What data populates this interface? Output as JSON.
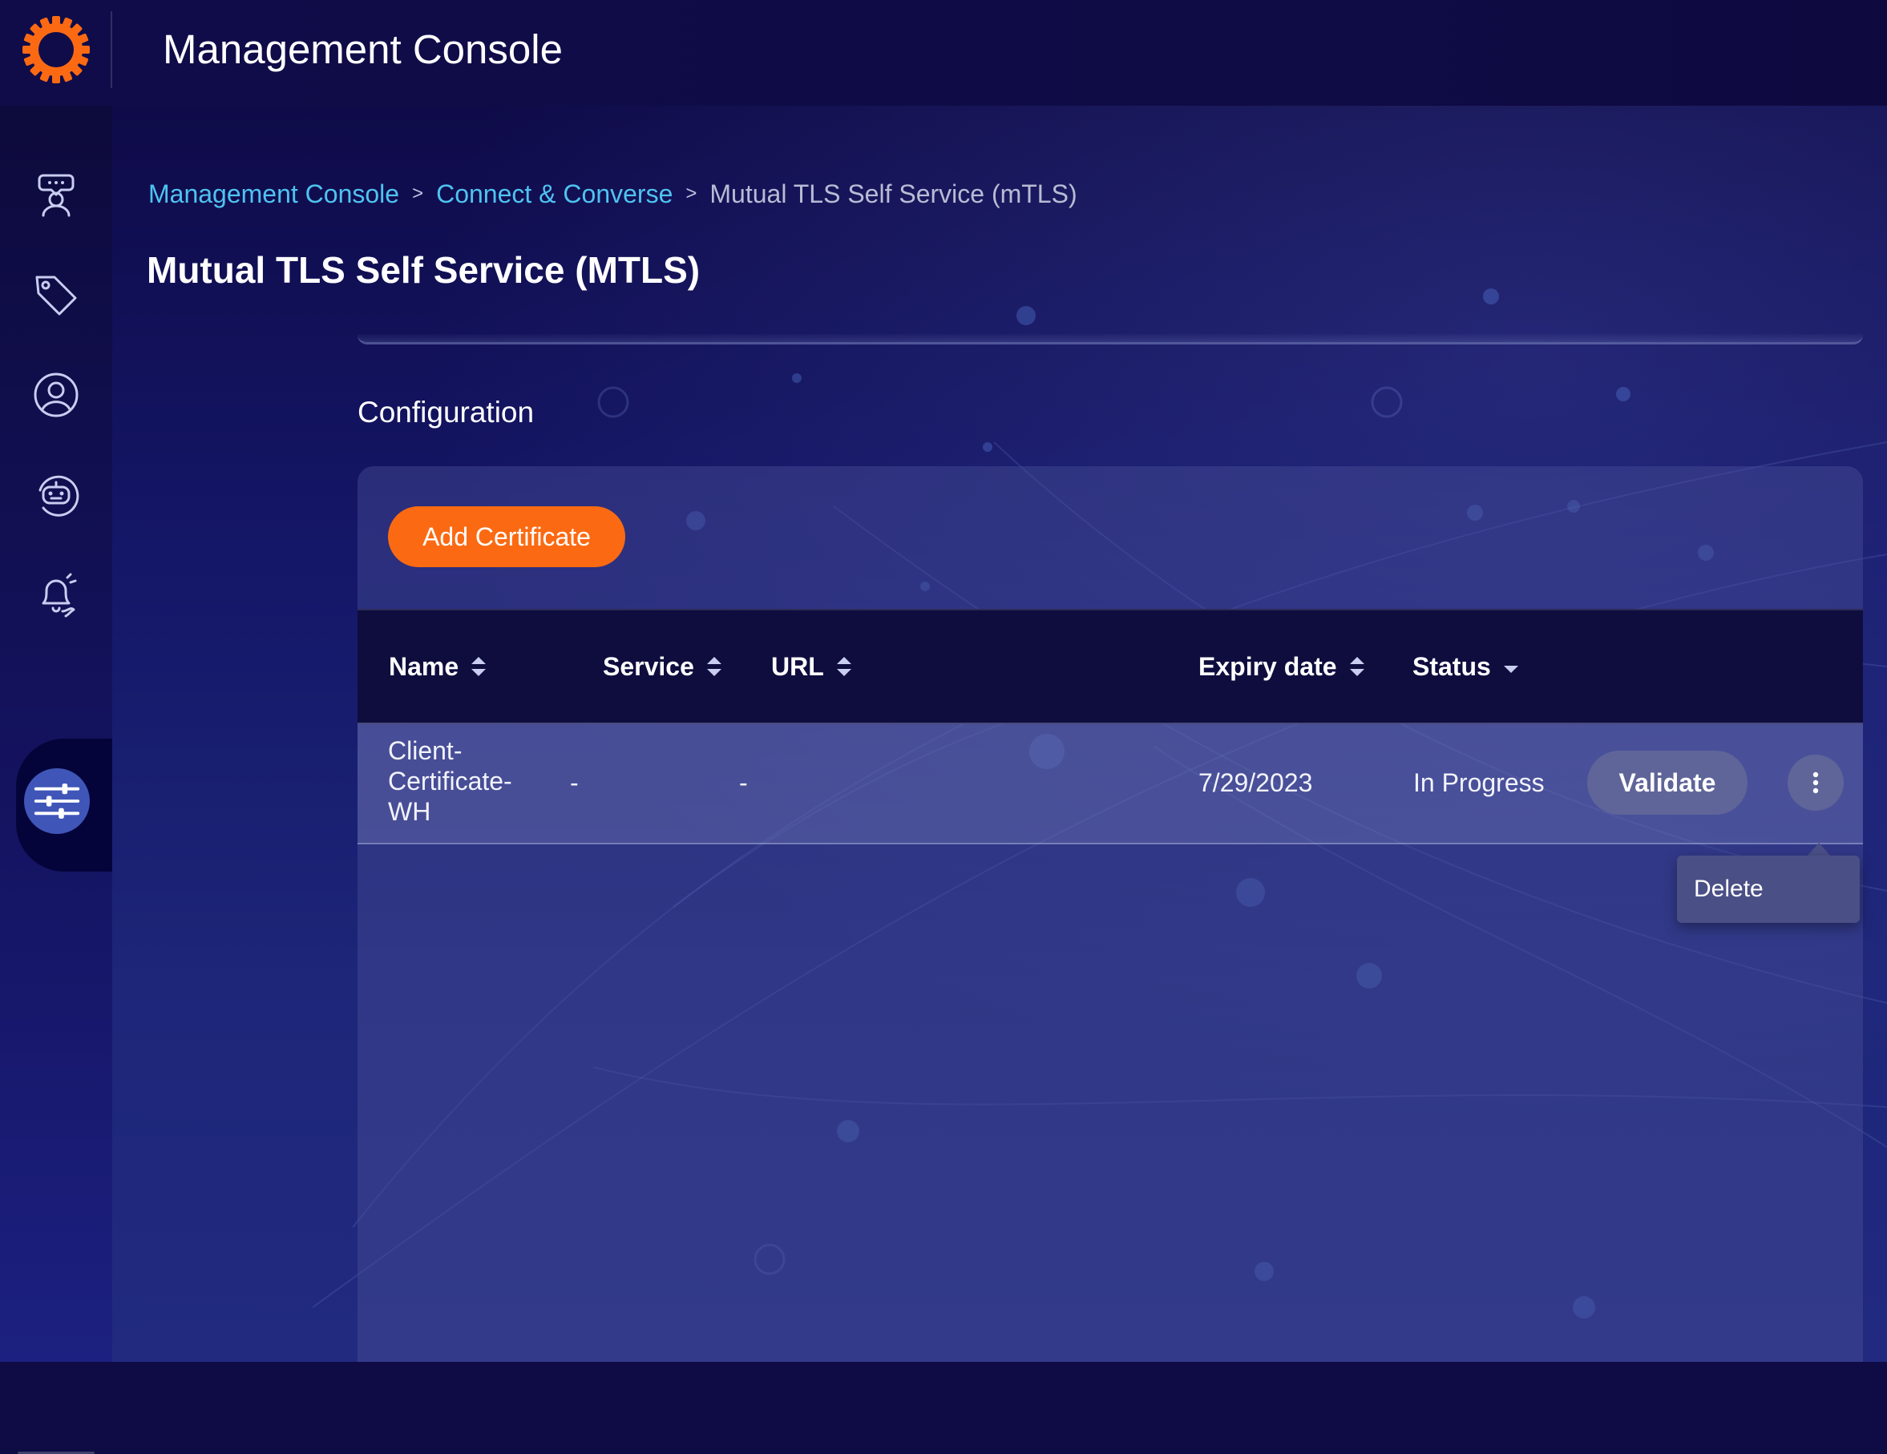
{
  "app": {
    "title": "Management Console",
    "logo_icon": "gear-logo-icon",
    "accent": "#fb6a12",
    "link_color": "#4fc3f0"
  },
  "rail": {
    "items": [
      {
        "icon": "agent-chat-icon",
        "active": false
      },
      {
        "icon": "tag-icon",
        "active": false
      },
      {
        "icon": "user-profile-icon",
        "active": false
      },
      {
        "icon": "bot-icon",
        "active": false
      },
      {
        "icon": "notification-bell-icon",
        "active": false
      },
      {
        "icon": "settings-sliders-icon",
        "active": true
      }
    ]
  },
  "breadcrumb": {
    "items": [
      {
        "label": "Management Console",
        "link": true
      },
      {
        "label": "Connect & Converse",
        "link": true
      },
      {
        "label": "Mutual TLS Self Service (mTLS)",
        "link": false
      }
    ],
    "separator": ">"
  },
  "page": {
    "title": "Mutual TLS Self Service (MTLS)",
    "section_title": "Configuration"
  },
  "toolbar": {
    "add_label": "Add Certificate"
  },
  "table": {
    "columns": [
      {
        "label": "Name",
        "sort": "both"
      },
      {
        "label": "Service",
        "sort": "both"
      },
      {
        "label": "URL",
        "sort": "both"
      },
      {
        "label": "Expiry date",
        "sort": "both"
      },
      {
        "label": "Status",
        "sort": "desc"
      }
    ],
    "rows": [
      {
        "name": "Client-Certificate-WH",
        "service": "-",
        "url": "-",
        "expiry": "7/29/2023",
        "status": "In Progress",
        "action_label": "Validate"
      }
    ]
  },
  "row_menu": {
    "items": [
      {
        "label": "Delete"
      }
    ]
  }
}
